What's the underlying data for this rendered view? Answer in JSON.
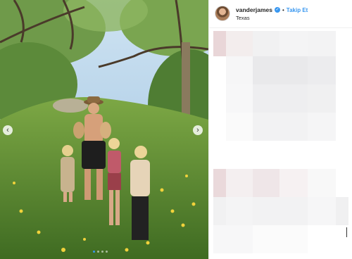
{
  "post": {
    "username": "vanderjames",
    "verified": true,
    "separator": "•",
    "follow_label": "Takip Et",
    "location": "Texas",
    "carousel": {
      "prev_icon": "chevron-left-icon",
      "next_icon": "chevron-right-icon",
      "slide_count": 4,
      "active_slide": 1
    },
    "colors": {
      "follow_blue": "#3897f0",
      "username_text": "#262626",
      "divider": "#efefef"
    }
  }
}
